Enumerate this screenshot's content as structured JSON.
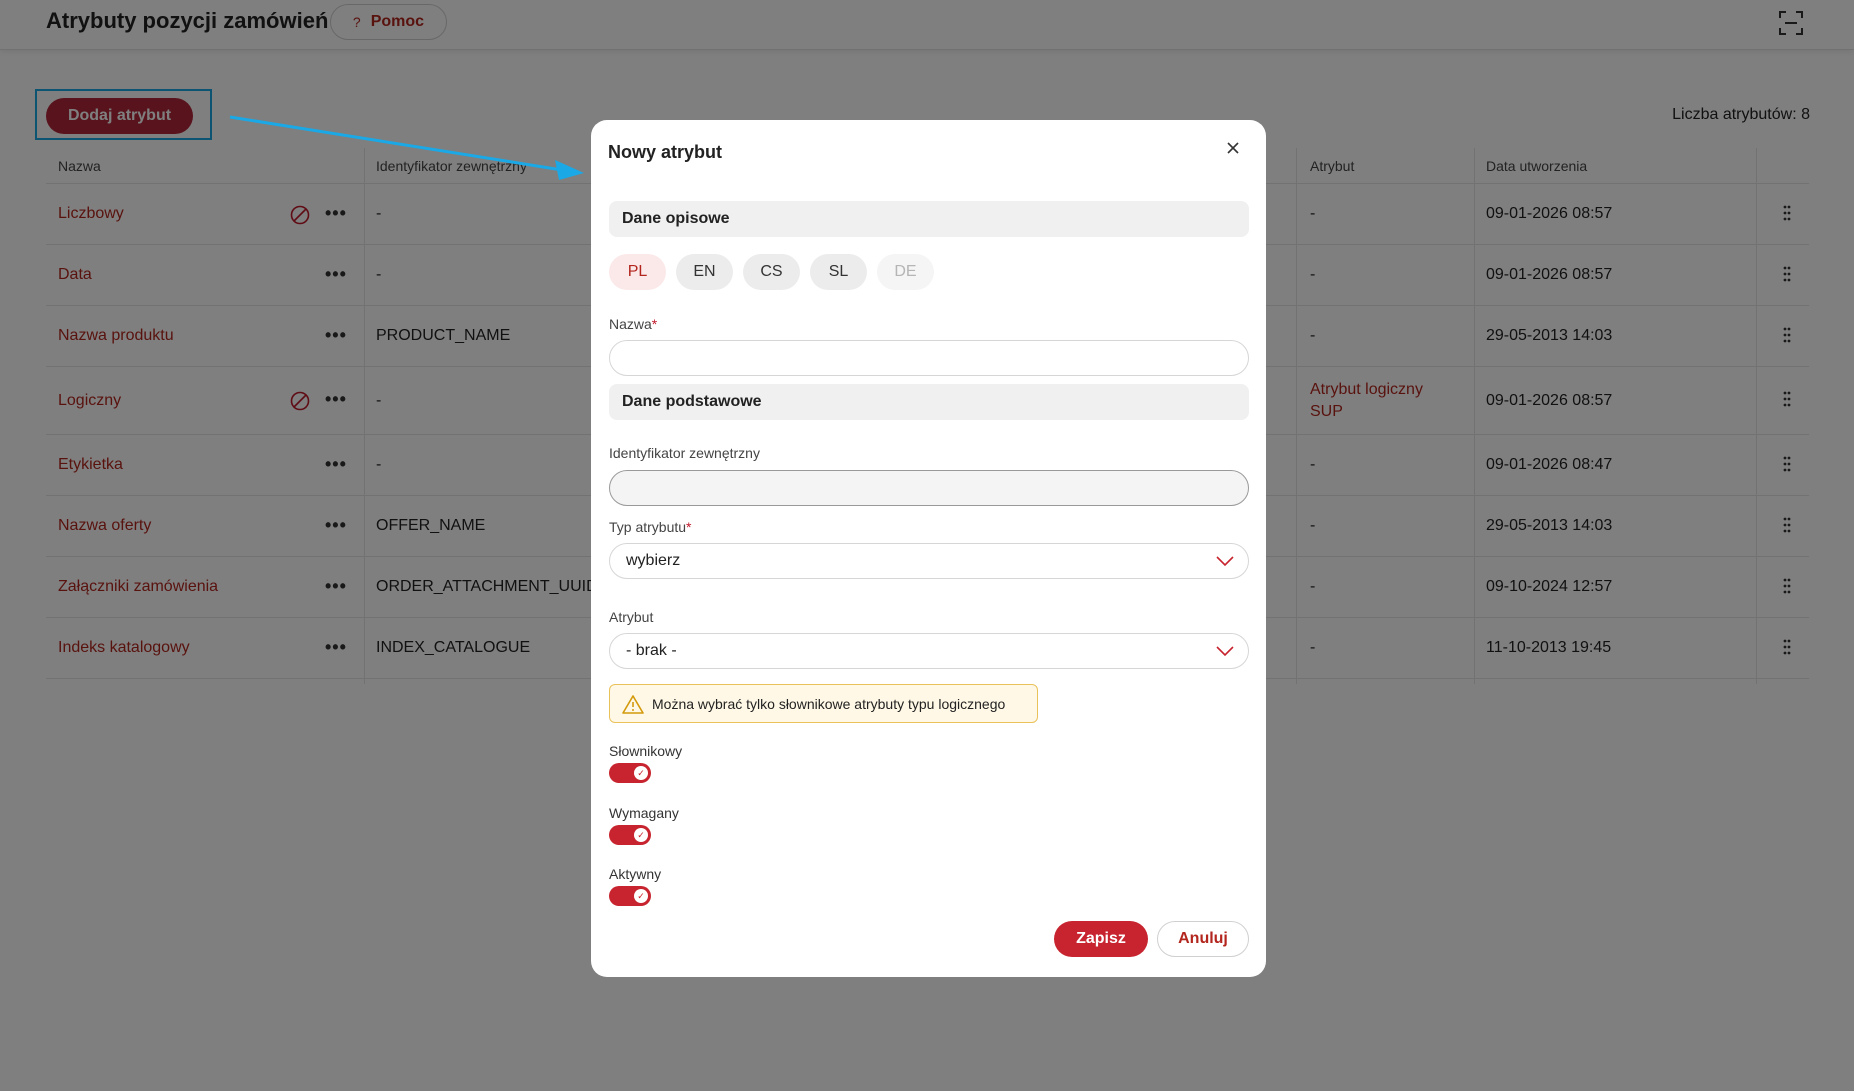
{
  "header": {
    "title": "Atrybuty pozycji zamówień",
    "help_label": "Pomoc",
    "help_icon": "?"
  },
  "toolbar": {
    "add_label": "Dodaj atrybut",
    "count_label": "Liczba atrybutów: 8"
  },
  "table": {
    "columns": {
      "name": "Nazwa",
      "external_id": "Identyfikator zewnętrzny",
      "attribute": "Atrybut",
      "created": "Data utworzenia"
    },
    "rows": [
      {
        "name": "Liczbowy",
        "external_id": "-",
        "attribute": "-",
        "created": "09-01-2026 08:57",
        "blocked": true
      },
      {
        "name": "Data",
        "external_id": "-",
        "attribute": "-",
        "created": "09-01-2026 08:57",
        "blocked": false
      },
      {
        "name": "Nazwa produktu",
        "external_id": "PRODUCT_NAME",
        "attribute": "-",
        "created": "29-05-2013 14:03",
        "blocked": false
      },
      {
        "name": "Logiczny",
        "external_id": "-",
        "attribute": "Atrybut logiczny SUP",
        "created": "09-01-2026 08:57",
        "blocked": true
      },
      {
        "name": "Etykietka",
        "external_id": "-",
        "attribute": "-",
        "created": "09-01-2026 08:47",
        "blocked": false
      },
      {
        "name": "Nazwa oferty",
        "external_id": "OFFER_NAME",
        "attribute": "-",
        "created": "29-05-2013 14:03",
        "blocked": false
      },
      {
        "name": "Załączniki zamówienia",
        "external_id": "ORDER_ATTACHMENT_UUID",
        "attribute": "-",
        "created": "09-10-2024 12:57",
        "blocked": false
      },
      {
        "name": "Indeks katalogowy",
        "external_id": "INDEX_CATALOGUE",
        "attribute": "-",
        "created": "11-10-2013 19:45",
        "blocked": false
      }
    ],
    "row_menu_label": "•••"
  },
  "modal": {
    "title": "Nowy atrybut",
    "section_descriptive": "Dane opisowe",
    "languages": [
      {
        "code": "PL",
        "state": "active"
      },
      {
        "code": "EN",
        "state": "normal"
      },
      {
        "code": "CS",
        "state": "normal"
      },
      {
        "code": "SL",
        "state": "normal"
      },
      {
        "code": "DE",
        "state": "disabled"
      }
    ],
    "name_label": "Nazwa",
    "name_value": "",
    "required_mark": "*",
    "section_basic": "Dane podstawowe",
    "external_id_label": "Identyfikator zewnętrzny",
    "external_id_value": "",
    "type_label": "Typ atrybutu",
    "type_value": "wybierz",
    "attribute_label": "Atrybut",
    "attribute_value": "- brak -",
    "warning": "Można wybrać tylko słownikowe atrybuty typu logicznego",
    "toggles": [
      {
        "label": "Słownikowy",
        "on": true
      },
      {
        "label": "Wymagany",
        "on": true
      },
      {
        "label": "Aktywny",
        "on": true
      }
    ],
    "save_label": "Zapisz",
    "cancel_label": "Anuluj"
  },
  "colors": {
    "accent": "#c8242f",
    "link": "#b3261e",
    "highlight": "#1aa9e6",
    "warning_border": "#e9c25a"
  }
}
